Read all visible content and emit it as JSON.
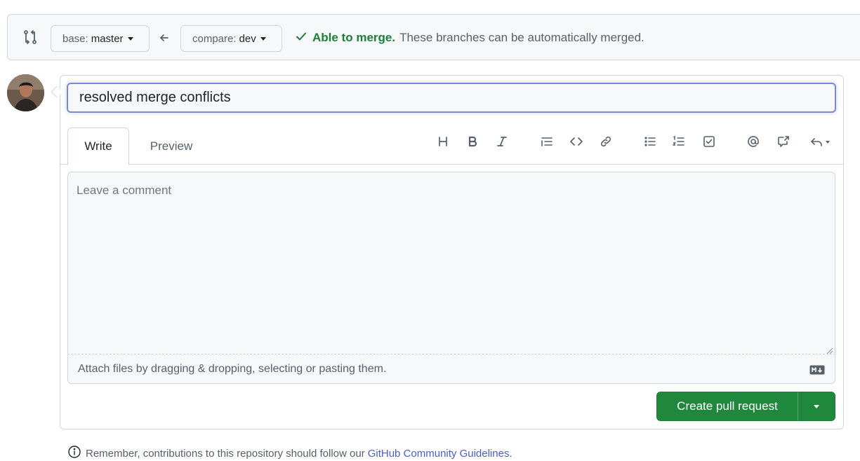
{
  "compare": {
    "base_label": "base:",
    "base_branch": "master",
    "compare_label": "compare:",
    "compare_branch": "dev",
    "merge_ok": "Able to merge.",
    "merge_msg": "These branches can be automatically merged."
  },
  "form": {
    "title_value": "resolved merge conflicts",
    "tabs": [
      {
        "label": "Write",
        "active": true
      },
      {
        "label": "Preview",
        "active": false
      }
    ],
    "toolbar": [
      "heading-icon",
      "bold-icon",
      "italic-icon",
      "quote-icon",
      "code-icon",
      "link-icon",
      "unordered-list-icon",
      "ordered-list-icon",
      "task-list-icon",
      "mention-icon",
      "cross-reference-icon",
      "saved-replies-icon"
    ],
    "comment_placeholder": "Leave a comment",
    "attach_text": "Attach files by dragging & dropping, selecting or pasting them.",
    "submit_label": "Create pull request"
  },
  "footer": {
    "remember_text": "Remember, contributions to this repository should follow our",
    "guidelines_link": "GitHub Community Guidelines",
    "period": "."
  },
  "colors": {
    "success": "#1a7f37",
    "primary_button": "#1f883d",
    "link": "#4a5fc1",
    "focus_border": "#7b86d6"
  }
}
